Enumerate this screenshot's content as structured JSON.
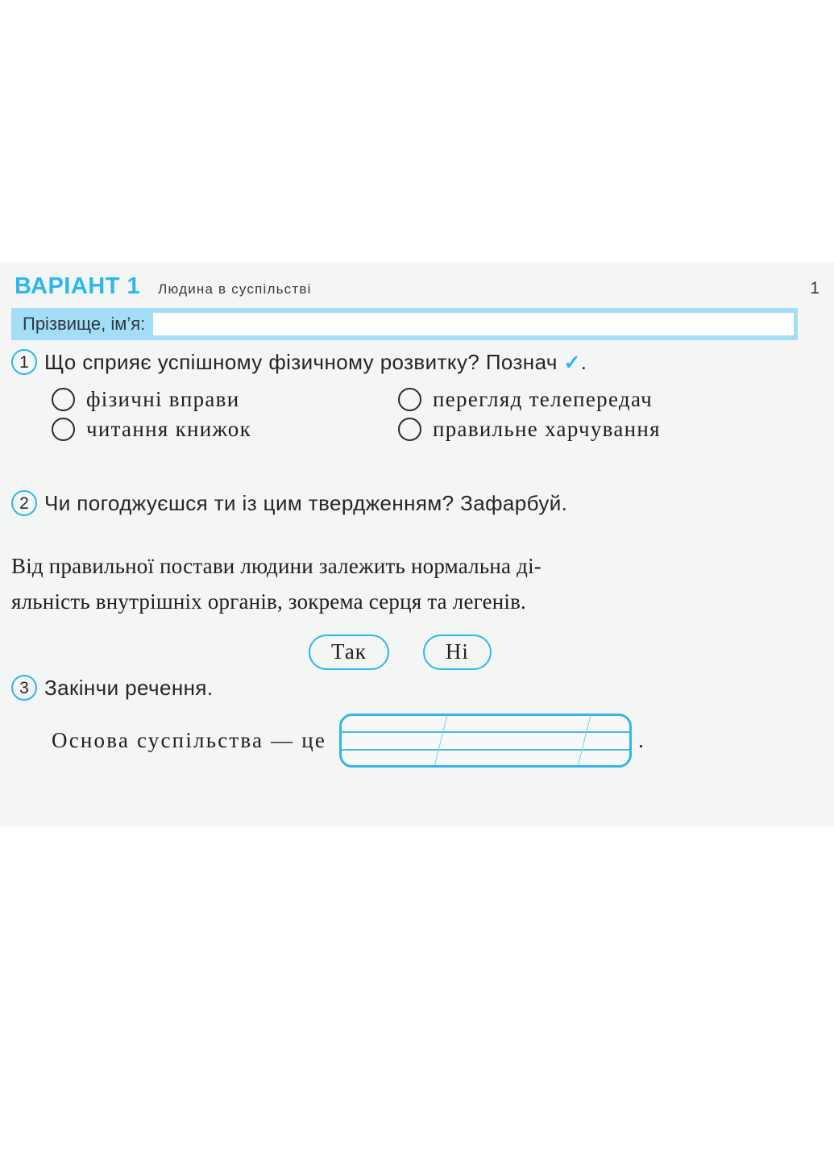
{
  "header": {
    "variant_title": "ВАРІАНТ 1",
    "subject": "Людина в суспільстві",
    "page_number": "1"
  },
  "name_field": {
    "label": "Прізвище, ім’я:",
    "value": "",
    "placeholder": ""
  },
  "questions": [
    {
      "number": "1",
      "prompt": "Що сприяє успішному фізичному розвитку? Познач",
      "check_glyph": "✓",
      "prompt_tail": ".",
      "options": [
        "фізичні вправи",
        "перегляд телепередач",
        "читання книжок",
        "правильне харчування"
      ]
    },
    {
      "number": "2",
      "prompt": "Чи погоджуєшся ти із цим твердженням? Зафарбуй.",
      "statement_line1": "Від правильної постави людини залежить нормальна ді-",
      "statement_line2": "яльність внутрішніх органів, зокрема серця та легенів.",
      "choices": [
        "Так",
        "Ні"
      ]
    },
    {
      "number": "3",
      "prompt": "Закінчи речення.",
      "sentence_lead": "Основа суспільства — це",
      "answer_value": "",
      "sentence_end": "."
    }
  ],
  "colors": {
    "accent": "#2bb8ee",
    "band": "#a4ddf6",
    "panel": "#f4f5f5",
    "rule": "#4cb9e5",
    "text": "#1f1f1f"
  }
}
